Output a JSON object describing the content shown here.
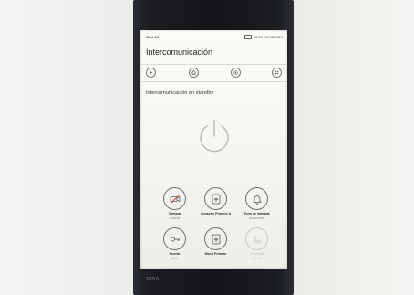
{
  "status": {
    "device_name": "Gira G1",
    "time": "13:21",
    "date": "16.08.2024"
  },
  "page_title": "Intercomunicación",
  "nav": {
    "back_icon": "arrow-left-icon",
    "home_icon": "home-icon",
    "settings_icon": "gear-icon",
    "apps_icon": "grid-icon"
  },
  "section": {
    "title": "Intercomunicación en standby",
    "power_icon": "power-icon"
  },
  "tiles": [
    {
      "label": "Cámara",
      "sublabel": "conectar",
      "icon": "camera-off-icon",
      "enabled": true
    },
    {
      "label": "Conserje Primero A",
      "sublabel": "",
      "icon": "door-call-icon",
      "enabled": true
    },
    {
      "label": "Tono de llamada",
      "sublabel": "desconectar",
      "icon": "bell-icon",
      "enabled": true
    },
    {
      "label": "Puerta",
      "sublabel": "abrir",
      "icon": "key-icon",
      "enabled": true
    },
    {
      "label": "Móvil Primero",
      "sublabel": "",
      "icon": "door-call-icon",
      "enabled": true
    },
    {
      "label": "Conectar",
      "sublabel": "llamada",
      "icon": "phone-icon",
      "enabled": false
    }
  ],
  "device_brand": "GIRA"
}
